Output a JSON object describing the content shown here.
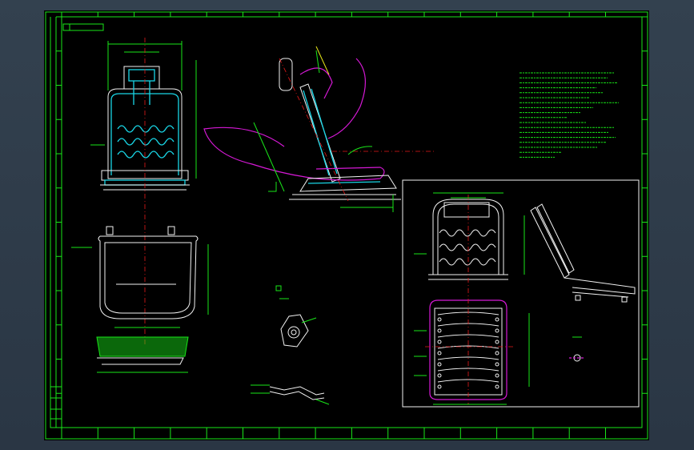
{
  "colors": {
    "background": "#000000",
    "frame": "#19e619",
    "outline": "#f2f2f2",
    "spring": "#19d6e6",
    "cushion": "#d619d6",
    "centerline": "#e61919",
    "viewport": "#2d3a4a"
  },
  "icons": {
    "drawing": "cad-seat-drawing",
    "front_view": "seat-front-view",
    "side_view": "seat-side-view",
    "top_view": "seat-cushion-top-view",
    "detail": "mechanism-detail",
    "inset": "seat-frame-inset"
  }
}
